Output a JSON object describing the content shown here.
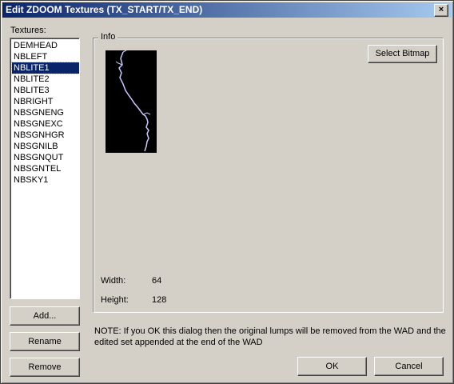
{
  "window": {
    "title": "Edit ZDOOM Textures (TX_START/TX_END)",
    "close_glyph": "×"
  },
  "textures": {
    "label": "Textures:",
    "items": [
      "DEMHEAD",
      "NBLEFT",
      "NBLITE1",
      "NBLITE2",
      "NBLITE3",
      "NBRIGHT",
      "NBSGNENG",
      "NBSGNEXC",
      "NBSGNHGR",
      "NBSGNILB",
      "NBSGNQUT",
      "NBSGNTEL",
      "NBSKY1"
    ],
    "selected_index": 2
  },
  "info": {
    "legend": "Info",
    "select_bitmap": "Select Bitmap",
    "width_label": "Width:",
    "width_value": "64",
    "height_label": "Height:",
    "height_value": "128"
  },
  "buttons": {
    "add": "Add...",
    "rename": "Rename",
    "remove": "Remove",
    "ok": "OK",
    "cancel": "Cancel"
  },
  "note": "NOTE: If you OK this dialog then the original lumps will be removed from the WAD and the edited set appended at the end of the WAD",
  "colors": {
    "titlebar_start": "#0a246a",
    "titlebar_end": "#a6caf0",
    "face": "#d4d0c8",
    "selection": "#0a246a",
    "lightning": "#c8c8ff"
  }
}
